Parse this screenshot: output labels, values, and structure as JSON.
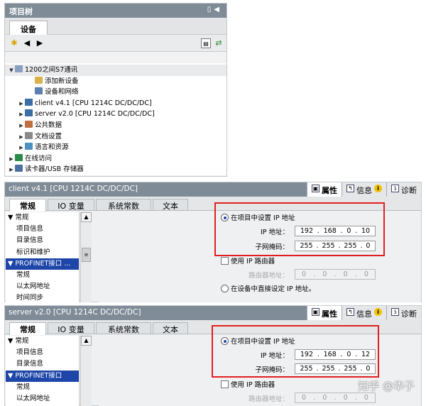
{
  "project_tree": {
    "title": "项目树",
    "tab": "设备",
    "items": [
      {
        "label": "1200之间S7通讯",
        "arrow": "▼",
        "indent": 0,
        "selected": true
      },
      {
        "label": "添加新设备",
        "arrow": "",
        "indent": 2,
        "selected": false
      },
      {
        "label": "设备和网络",
        "arrow": "",
        "indent": 2,
        "selected": false
      },
      {
        "label": "client v4.1 [CPU 1214C DC/DC/DC]",
        "arrow": "▶",
        "indent": 1,
        "selected": false
      },
      {
        "label": "server v2.0 [CPU 1214C DC/DC/DC]",
        "arrow": "▶",
        "indent": 1,
        "selected": false
      },
      {
        "label": "公共数据",
        "arrow": "▶",
        "indent": 1,
        "selected": false
      },
      {
        "label": "文档设置",
        "arrow": "▶",
        "indent": 1,
        "selected": false
      },
      {
        "label": "语言和资源",
        "arrow": "▶",
        "indent": 1,
        "selected": false
      },
      {
        "label": "在线访问",
        "arrow": "▶",
        "indent": 0,
        "selected": false
      },
      {
        "label": "读卡器/USB 存储器",
        "arrow": "▶",
        "indent": 0,
        "selected": false
      }
    ]
  },
  "panel1": {
    "title": "client v4.1 [CPU 1214C DC/DC/DC]",
    "right_tabs": [
      "属性",
      "信息",
      "诊断"
    ],
    "left_tabs": [
      "常规",
      "IO 变量",
      "系统常数",
      "文本"
    ],
    "nav": [
      "▼ 常规",
      "项目信息",
      "目录信息",
      "标识和维护",
      "▼ PROFINET接口 ...",
      "常规",
      "以太网地址",
      "时间同步"
    ],
    "opt_project_ip": "在项目中设置 IP 地址",
    "ip_label": "IP 地址：",
    "ip": [
      "192",
      "168",
      "0",
      "10"
    ],
    "mask_label": "子网掩码：",
    "mask": [
      "255",
      "255",
      "255",
      "0"
    ],
    "use_router": "使用 IP 路由器",
    "router_label": "路由器地址：",
    "router": [
      "0",
      "0",
      "0",
      "0"
    ],
    "opt_device_ip": "在设备中直接设定 IP 地址。"
  },
  "panel2": {
    "title": "server v2.0 [CPU 1214C DC/DC/DC]",
    "right_tabs": [
      "属性",
      "信息",
      "诊断"
    ],
    "left_tabs": [
      "常规",
      "IO 变量",
      "系统常数",
      "文本"
    ],
    "nav": [
      "▼ 常规",
      "项目信息",
      "目录信息",
      "▼ PROFINET接口",
      "常规",
      "以太网地址"
    ],
    "opt_project_ip": "在项目中设置 IP 地址",
    "ip_label": "IP 地址：",
    "ip": [
      "192",
      "168",
      "0",
      "12"
    ],
    "mask_label": "子网掩码：",
    "mask": [
      "255",
      "255",
      "255",
      "0"
    ],
    "use_router": "使用 IP 路由器",
    "router_label": "路由器地址：",
    "router": [
      "0",
      "0",
      "0",
      "0"
    ]
  },
  "watermark": "知乎 @华子"
}
